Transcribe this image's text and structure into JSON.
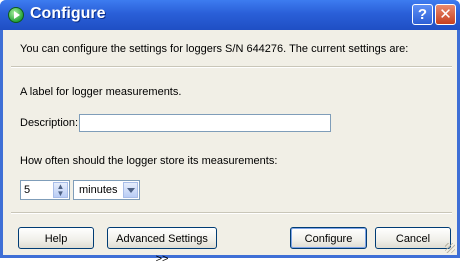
{
  "window": {
    "title": "Configure",
    "title_help": "?",
    "title_close": "✕"
  },
  "intro": "You can configure the settings for loggers S/N 644276. The current settings are:",
  "label_section": {
    "heading": "A label for logger measurements.",
    "description_label": "Description:",
    "description_value": ""
  },
  "interval_section": {
    "heading": "How often should the logger store its measurements:",
    "value": "5",
    "unit_selected": "minutes"
  },
  "buttons": {
    "help": "Help",
    "advanced": "Advanced Settings >>",
    "configure": "Configure",
    "cancel": "Cancel"
  },
  "colors": {
    "titlebar": "#2a5fd8",
    "dialog_background": "#f1efe6"
  }
}
